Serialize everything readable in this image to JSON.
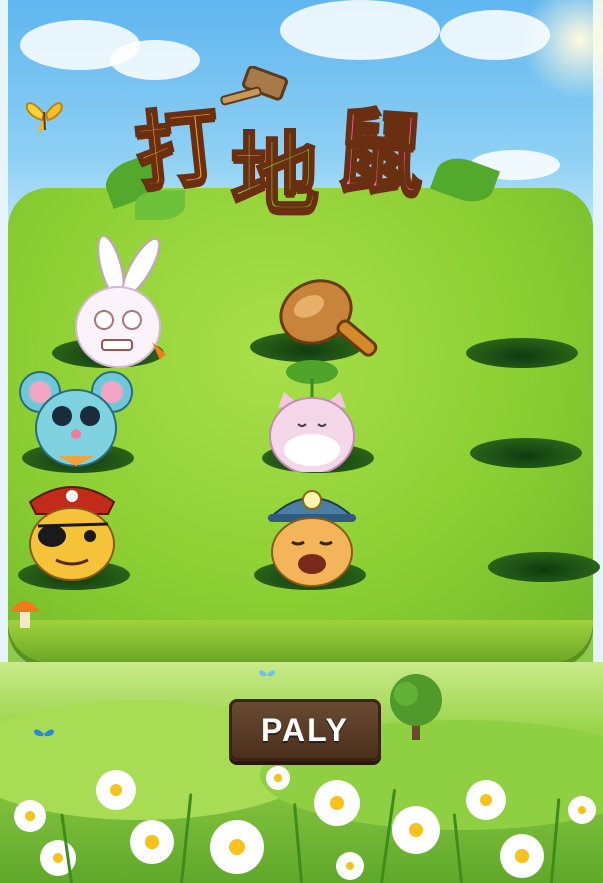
{
  "game": {
    "title_chars": [
      "打",
      "地",
      "鼠"
    ],
    "play_button_label": "PALY"
  },
  "colors": {
    "sky": "#5fb6ef",
    "field": "#8ccf33",
    "title_char_1": "#f5a21b",
    "title_char_2": "#8fd33a",
    "title_char_3": "#f06aa0",
    "button": "#4a2f1c"
  },
  "board": {
    "rows": [
      [
        "rabbit",
        "empty",
        "empty"
      ],
      [
        "mouse",
        "cat",
        "empty"
      ],
      [
        "pirate-cat",
        "miner-cat",
        "empty"
      ]
    ],
    "hammer": "wooden-mallet-icon"
  }
}
